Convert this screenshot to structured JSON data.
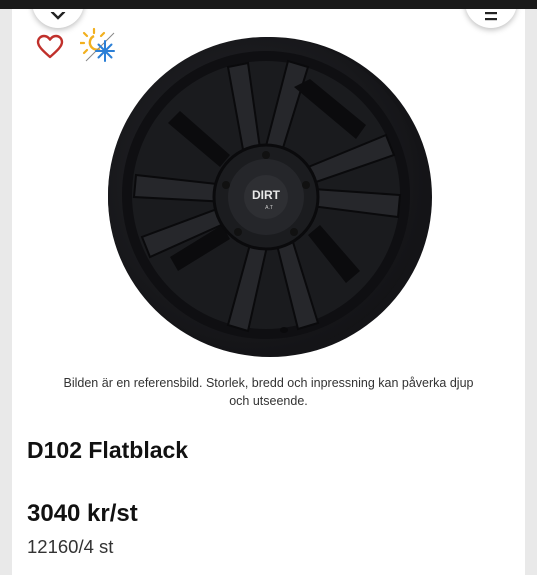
{
  "header": {
    "close_icon": "close-icon",
    "menu_icon": "menu-icon"
  },
  "product": {
    "favorite_icon": "heart-icon",
    "season_icon": "all-season-sun-snowflake-icon",
    "image_caption": "Bilden är en referensbild. Storlek, bredd och inpressning kan påverka djup och utseende.",
    "brand_logo_line1": "DIRT",
    "brand_logo_line2": "A.T",
    "name": "D102 Flatblack",
    "price": "3040 kr/st",
    "total_price": "12160/4 st"
  },
  "colors": {
    "heart": "#c0302b",
    "sun": "#f2b01e",
    "snowflake": "#2b7fd6",
    "wheel": "#1c1d20"
  }
}
